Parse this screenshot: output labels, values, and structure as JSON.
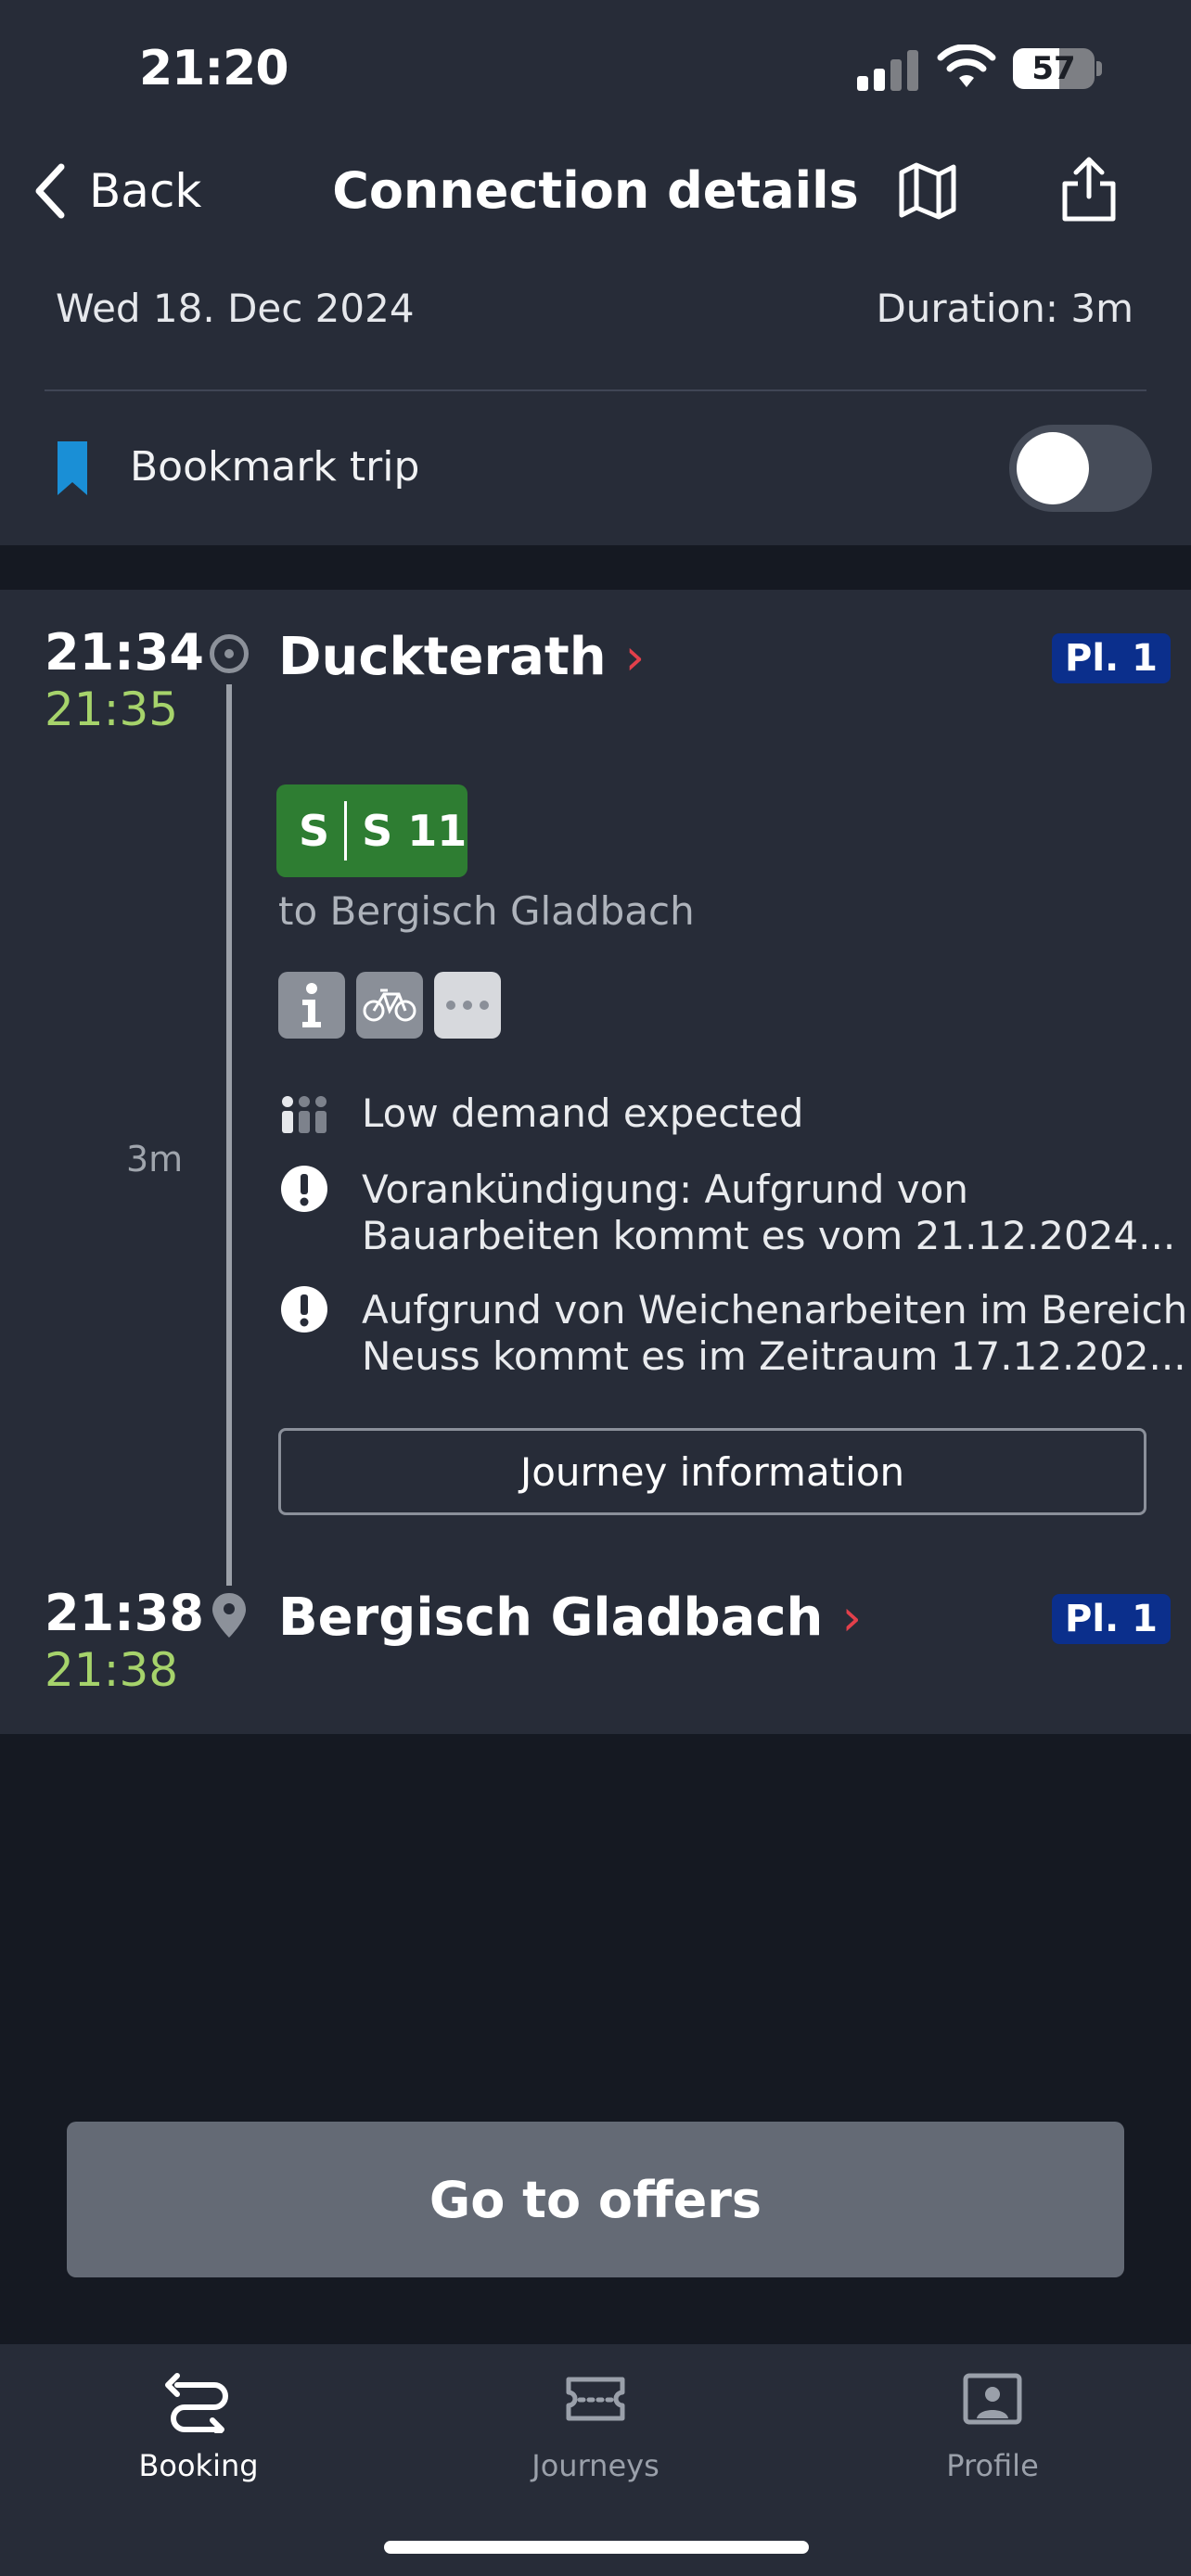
{
  "status_bar": {
    "time": "21:20",
    "battery": "57",
    "battery_level": 0.57
  },
  "header": {
    "back_label": "Back",
    "title": "Connection details",
    "map_icon": "map-icon",
    "share_icon": "share-icon",
    "date": "Wed 18. Dec 2024",
    "duration": "Duration: 3m",
    "bookmark_label": "Bookmark trip",
    "bookmark_on": false
  },
  "trip": {
    "departure": {
      "time": "21:34",
      "realtime": "21:35",
      "station": "Duckterath",
      "platform": "Pl. 1"
    },
    "line": {
      "product": "S",
      "name": "S 11",
      "direction": "to Bergisch Gladbach"
    },
    "features": [
      "info-icon",
      "bicycle-icon",
      "more-icon"
    ],
    "travel_time": "3m",
    "notices": [
      {
        "icon": "people-icon",
        "text": "Low demand expected"
      },
      {
        "icon": "warning-icon",
        "text_line1": "Vorankündigung: Aufgrund von",
        "text_line2": "Bauarbeiten kommt es vom 21.12.2024..."
      },
      {
        "icon": "warning-icon",
        "text_line1": "Aufgrund von Weichenarbeiten im Bereich",
        "text_line2": "Neuss kommt es im Zeitraum 17.12.202..."
      }
    ],
    "journey_info_label": "Journey information",
    "arrival": {
      "time": "21:38",
      "realtime": "21:38",
      "station": "Bergisch Gladbach",
      "platform": "Pl. 1"
    }
  },
  "cta": {
    "offers_label": "Go to offers"
  },
  "tabs": [
    {
      "label": "Booking",
      "active": true
    },
    {
      "label": "Journeys",
      "active": false
    },
    {
      "label": "Profile",
      "active": false
    }
  ],
  "colors": {
    "accent_red": "#e2404b",
    "realtime_green": "#a6d36b",
    "line_green": "#2e7d32",
    "platform_blue": "#0b2f8c",
    "bookmark_blue": "#1a8fd6"
  }
}
